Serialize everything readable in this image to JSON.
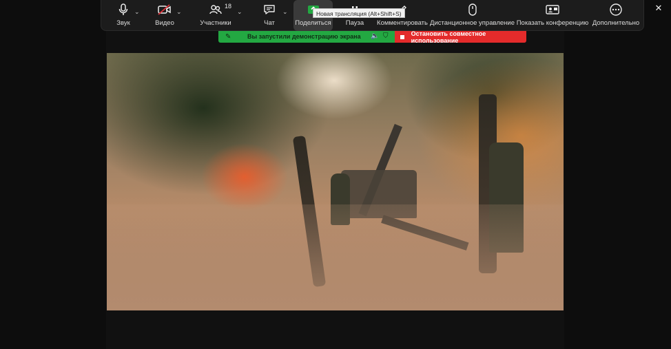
{
  "toolbar": {
    "items": [
      {
        "label": "Звук",
        "icon": "microphone-icon"
      },
      {
        "label": "Видео",
        "icon": "video-off-icon"
      },
      {
        "label": "Участники",
        "icon": "participants-icon",
        "count": "18"
      },
      {
        "label": "Чат",
        "icon": "chat-icon"
      },
      {
        "label": "Поделиться",
        "icon": "share-screen-icon"
      },
      {
        "label": "Пауза",
        "icon": "pause-icon"
      },
      {
        "label": "Комментировать",
        "icon": "annotate-icon"
      },
      {
        "label": "Дистанционное управление",
        "icon": "remote-control-icon"
      },
      {
        "label": "Показать конференцию",
        "icon": "show-meeting-icon"
      },
      {
        "label": "Дополнительно",
        "icon": "more-icon"
      }
    ],
    "tooltip": "Новая трансляция (Alt+Shift+S)"
  },
  "share_banner": {
    "status": "Вы запустили демонстрацию экрана",
    "stop_label": "Остановить совместное использование"
  },
  "colors": {
    "toolbar_bg": "#1c1c1c",
    "banner_green": "#23a842",
    "banner_red": "#e42b2b",
    "video_off_red": "#e0333b"
  }
}
